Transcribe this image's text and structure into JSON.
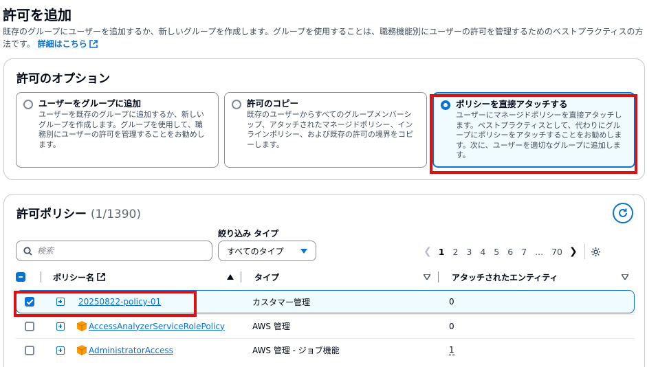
{
  "header": {
    "title": "許可を追加",
    "description": "既存のグループにユーザーを追加するか、新しいグループを作成します。グループを使用することは、職務機能別にユーザーの許可を管理するためのベストプラクティスの方法です。",
    "learn_more": "詳細はこちら"
  },
  "options": {
    "title": "許可のオプション",
    "cards": [
      {
        "title": "ユーザーをグループに追加",
        "description": "ユーザーを既存のグループに追加するか、新しいグループを作成します。グループを使用して、職務別にユーザーの許可を管理することをお勧めします。",
        "selected": false
      },
      {
        "title": "許可のコピー",
        "description": "既存のユーザーからすべてのグループメンバーシップ、アタッチされたマネージドポリシー、インラインポリシー、および既存の許可の境界をコピーします。",
        "selected": false
      },
      {
        "title": "ポリシーを直接アタッチする",
        "description": "ユーザーにマネージドポリシーを直接アタッチします。ベストプラクティスとして、代わりにグループにポリシーをアタッチすることをお勧めします。次に、ユーザーを適切なグループに追加します。",
        "selected": true
      }
    ]
  },
  "policies": {
    "title": "許可ポリシー",
    "count": "(1/1390)",
    "filter_label": "絞り込み タイプ",
    "search_placeholder": "検索",
    "type_select": "すべてのタイプ",
    "pagination": {
      "pages": [
        "1",
        "2",
        "3",
        "4",
        "5",
        "6",
        "7",
        "...",
        "70"
      ],
      "current": "1"
    },
    "columns": {
      "name": "ポリシー名",
      "type": "タイプ",
      "entities": "アタッチされたエンティティ"
    },
    "rows": [
      {
        "name": "20250822-policy-01",
        "type": "カスタマー管理",
        "entities": "0",
        "checked": true,
        "aws_icon": false
      },
      {
        "name": "AccessAnalyzerServiceRolePolicy",
        "type": "AWS 管理",
        "entities": "0",
        "checked": false,
        "aws_icon": true
      },
      {
        "name": "AdministratorAccess",
        "type": "AWS 管理 - ジョブ機能",
        "entities": "1",
        "checked": false,
        "aws_icon": true
      }
    ]
  },
  "colors": {
    "accent": "#0972d3",
    "highlight": "#e01010",
    "aws_orange": "#ff9900"
  }
}
